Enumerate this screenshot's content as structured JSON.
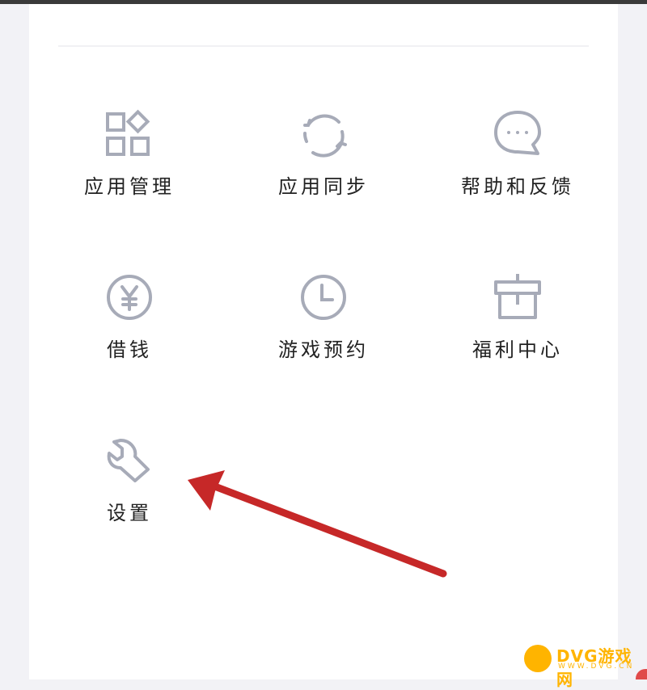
{
  "menu": {
    "items": [
      {
        "label": "应用管理",
        "icon": "apps-grid-icon"
      },
      {
        "label": "应用同步",
        "icon": "sync-icon"
      },
      {
        "label": "帮助和反馈",
        "icon": "chat-bubble-icon"
      },
      {
        "label": "借钱",
        "icon": "yen-circle-icon"
      },
      {
        "label": "游戏预约",
        "icon": "clock-icon"
      },
      {
        "label": "福利中心",
        "icon": "gift-icon"
      },
      {
        "label": "设置",
        "icon": "wrench-icon"
      }
    ]
  },
  "annotation": {
    "arrow_color": "#c62828",
    "points_to": "设置"
  },
  "watermark": {
    "text": "DVG游戏网",
    "sub": "WWW.DVG.CN"
  },
  "colors": {
    "icon_stroke": "#a7abb8",
    "label_text": "#222222",
    "accent": "#ffb400"
  }
}
